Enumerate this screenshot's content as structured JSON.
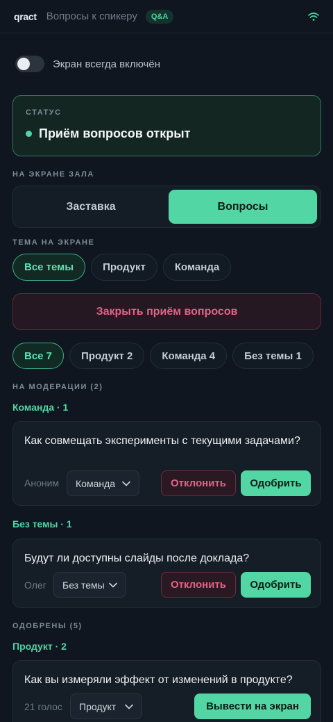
{
  "header": {
    "logo": "qract",
    "title": "Вопросы к спикеру",
    "badge": "Q&A"
  },
  "screen_toggle": {
    "label": "Экран всегда включён",
    "on": false
  },
  "status": {
    "caption": "СТАТУС",
    "text": "Приём вопросов открыт",
    "color": "#52d6a4"
  },
  "hall_screen": {
    "caption": "НА ЭКРАНЕ ЗАЛА",
    "options": [
      "Заставка",
      "Вопросы"
    ],
    "selected": "Вопросы"
  },
  "screen_topic": {
    "caption": "ТЕМА НА ЭКРАНЕ",
    "chips": [
      "Все темы",
      "Продукт",
      "Команда"
    ],
    "selected": "Все темы"
  },
  "close_button": "Закрыть приём вопросов",
  "filters": {
    "chips": [
      "Все 7",
      "Продукт 2",
      "Команда 4",
      "Без темы 1"
    ],
    "selected": "Все 7"
  },
  "moderation": {
    "caption": "НА МОДЕРАЦИИ (2)",
    "groups": [
      {
        "title": "Команда · 1",
        "question": {
          "text": "Как совмещать эксперименты с текущими задачами?",
          "author": "Аноним",
          "topic": "Команда",
          "reject": "Отклонить",
          "approve": "Одобрить"
        }
      },
      {
        "title": "Без темы · 1",
        "question": {
          "text": "Будут ли доступны слайды после доклада?",
          "author": "Олег",
          "topic": "Без темы",
          "reject": "Отклонить",
          "approve": "Одобрить"
        }
      }
    ]
  },
  "approved": {
    "caption": "ОДОБРЕНЫ (5)",
    "groups": [
      {
        "title": "Продукт · 2",
        "question": {
          "text": "Как вы измеряли эффект от изменений в продукте?",
          "votes": "21 голос",
          "topic": "Продукт",
          "action": "Вывести на экран"
        }
      }
    ]
  },
  "colors": {
    "accent": "#52d6a4",
    "danger": "#e76086",
    "background": "#0f1620"
  }
}
